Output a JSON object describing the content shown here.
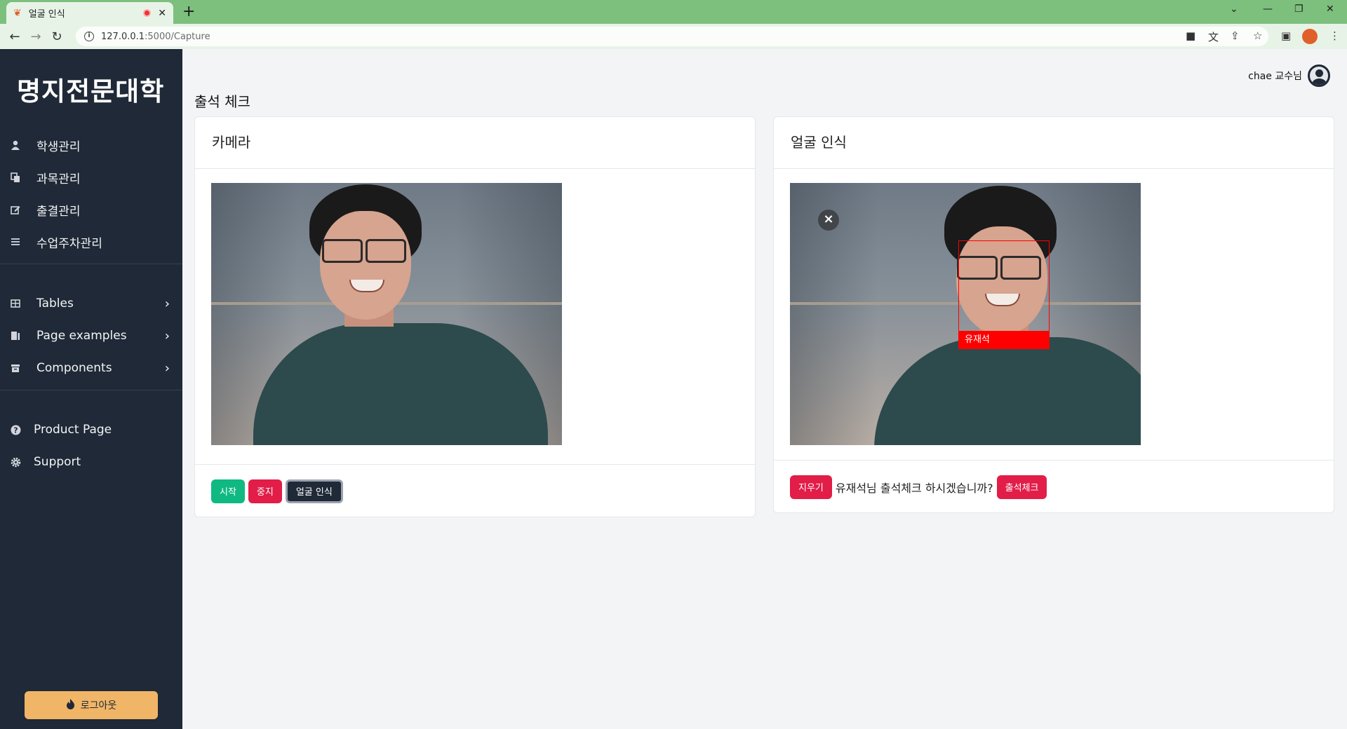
{
  "browser": {
    "tab_title": "얼굴 인식",
    "new_tab": "+",
    "url_host": "127.0.0.1",
    "url_path": ":5000/Capture"
  },
  "sidebar": {
    "brand": "명지전문대학",
    "items": [
      {
        "label": "학생관리",
        "icon": "user-icon"
      },
      {
        "label": "과목관리",
        "icon": "copy-icon"
      },
      {
        "label": "출결관리",
        "icon": "edit-icon"
      },
      {
        "label": "수업주차관리",
        "icon": "list-icon"
      }
    ],
    "expandable": [
      {
        "label": "Tables",
        "icon": "table-icon"
      },
      {
        "label": "Page examples",
        "icon": "pages-icon"
      },
      {
        "label": "Components",
        "icon": "archive-icon"
      }
    ],
    "links": [
      {
        "label": "Product Page",
        "icon": "question-icon"
      },
      {
        "label": "Support",
        "icon": "gear-icon"
      }
    ],
    "logout_label": "로그아웃"
  },
  "header": {
    "user": "chae 교수님"
  },
  "page": {
    "title": "출석 체크"
  },
  "camera_card": {
    "title": "카메라",
    "buttons": {
      "start": "시작",
      "stop": "중지",
      "recognize": "얼굴 인식"
    }
  },
  "recognition_card": {
    "title": "얼굴 인식",
    "detected_name": "유재석",
    "clear_label": "지우기",
    "confirm_text": "유재석님 출석체크 하시겠습니까?",
    "check_label": "출석체크"
  },
  "colors": {
    "sidebar_bg": "#1f2937",
    "accent_green": "#10b981",
    "accent_red": "#e11d48",
    "logout_bg": "#f0b567",
    "detection_box": "#ff0000"
  }
}
